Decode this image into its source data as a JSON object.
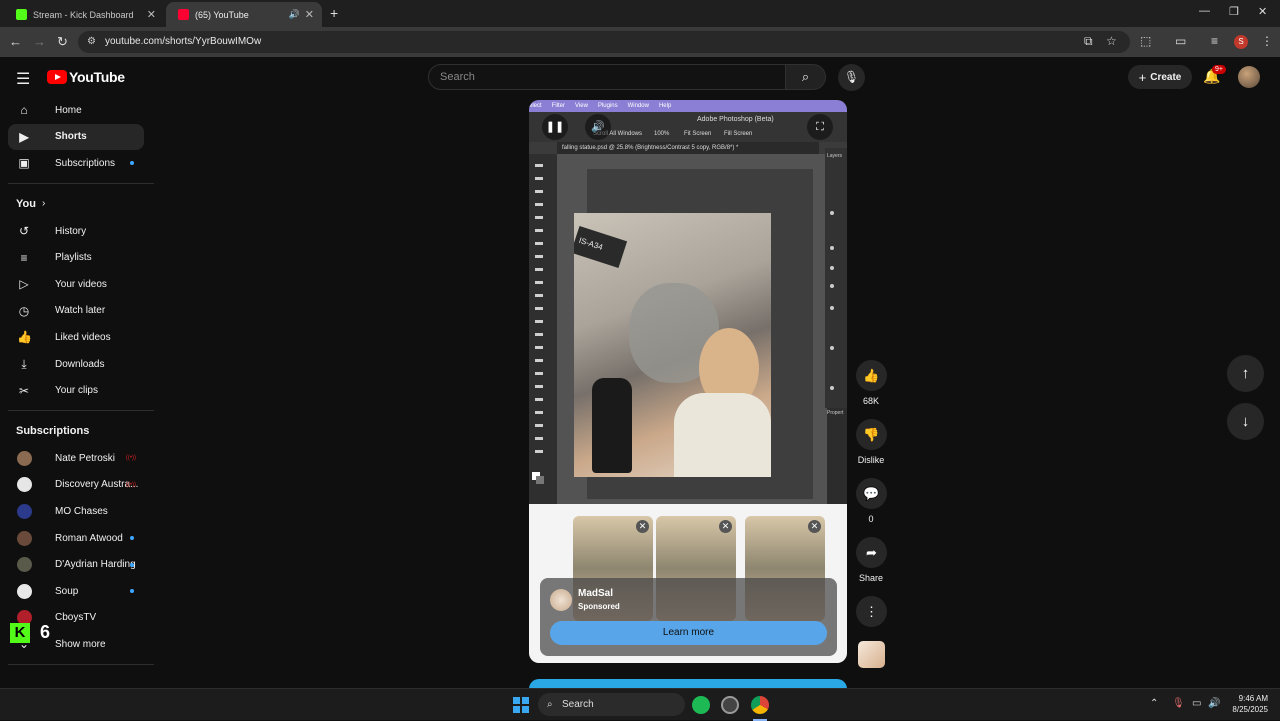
{
  "browser": {
    "tabs": [
      {
        "label": "Stream - Kick Dashboard",
        "active": false
      },
      {
        "label": "(65) YouTube",
        "active": true
      }
    ],
    "url": "youtube.com/shorts/YyrBouwIMOw",
    "profile_initial": "S"
  },
  "masthead": {
    "logo_text": "YouTube",
    "search_placeholder": "Search",
    "create_label": "Create",
    "notification_badge": "9+"
  },
  "sidebar": {
    "main": [
      {
        "label": "Home",
        "icon": "home-icon"
      },
      {
        "label": "Shorts",
        "icon": "shorts-icon",
        "active": true
      },
      {
        "label": "Subscriptions",
        "icon": "subscriptions-icon",
        "dot": true
      }
    ],
    "you_heading": "You",
    "you": [
      {
        "label": "History",
        "icon": "history-icon"
      },
      {
        "label": "Playlists",
        "icon": "playlists-icon"
      },
      {
        "label": "Your videos",
        "icon": "your-videos-icon"
      },
      {
        "label": "Watch later",
        "icon": "watch-later-icon"
      },
      {
        "label": "Liked videos",
        "icon": "liked-videos-icon"
      },
      {
        "label": "Downloads",
        "icon": "downloads-icon"
      },
      {
        "label": "Your clips",
        "icon": "clips-icon"
      }
    ],
    "subscriptions_heading": "Subscriptions",
    "subscriptions": [
      {
        "label": "Nate Petroski",
        "color": "#8a6a50",
        "indicator": "live"
      },
      {
        "label": "Discovery Austra...",
        "color": "#e6e6e6",
        "indicator": "live"
      },
      {
        "label": "MO Chases",
        "color": "#2b3a8a",
        "indicator": "none"
      },
      {
        "label": "Roman Atwood",
        "color": "#6a4a3a",
        "indicator": "dot"
      },
      {
        "label": "D'Aydrian Harding",
        "color": "#5a5a4a",
        "indicator": "dot"
      },
      {
        "label": "Soup",
        "color": "#e8e8e8",
        "indicator": "dot"
      },
      {
        "label": "CboysTV",
        "color": "#b01f2a",
        "indicator": "none"
      }
    ],
    "show_more": "Show more"
  },
  "player": {
    "photoshop_menu": [
      "elect",
      "Filter",
      "View",
      "Plugins",
      "Window",
      "Help"
    ],
    "photoshop_title": "Adobe Photoshop (Beta)",
    "photoshop_options": [
      "Scroll All Windows",
      "100%",
      "Fit Screen",
      "Fill Screen"
    ],
    "photoshop_doc_tab": "falling statue.psd @ 25.8% (Brightness/Contrast 5 copy, RGB/8*) *",
    "photoshop_layers_label": "Layers",
    "photoshop_properties_label": "Propert",
    "photo_label": "IS-A34"
  },
  "ad": {
    "name": "MadSal",
    "sponsored": "Sponsored",
    "cta": "Learn more"
  },
  "actions": {
    "like_count": "68K",
    "dislike_label": "Dislike",
    "comment_count": "0",
    "share_label": "Share"
  },
  "overlay": {
    "kick_count": "6"
  },
  "taskbar": {
    "search_label": "Search",
    "time": "9:46 AM",
    "date": "8/25/2025"
  }
}
